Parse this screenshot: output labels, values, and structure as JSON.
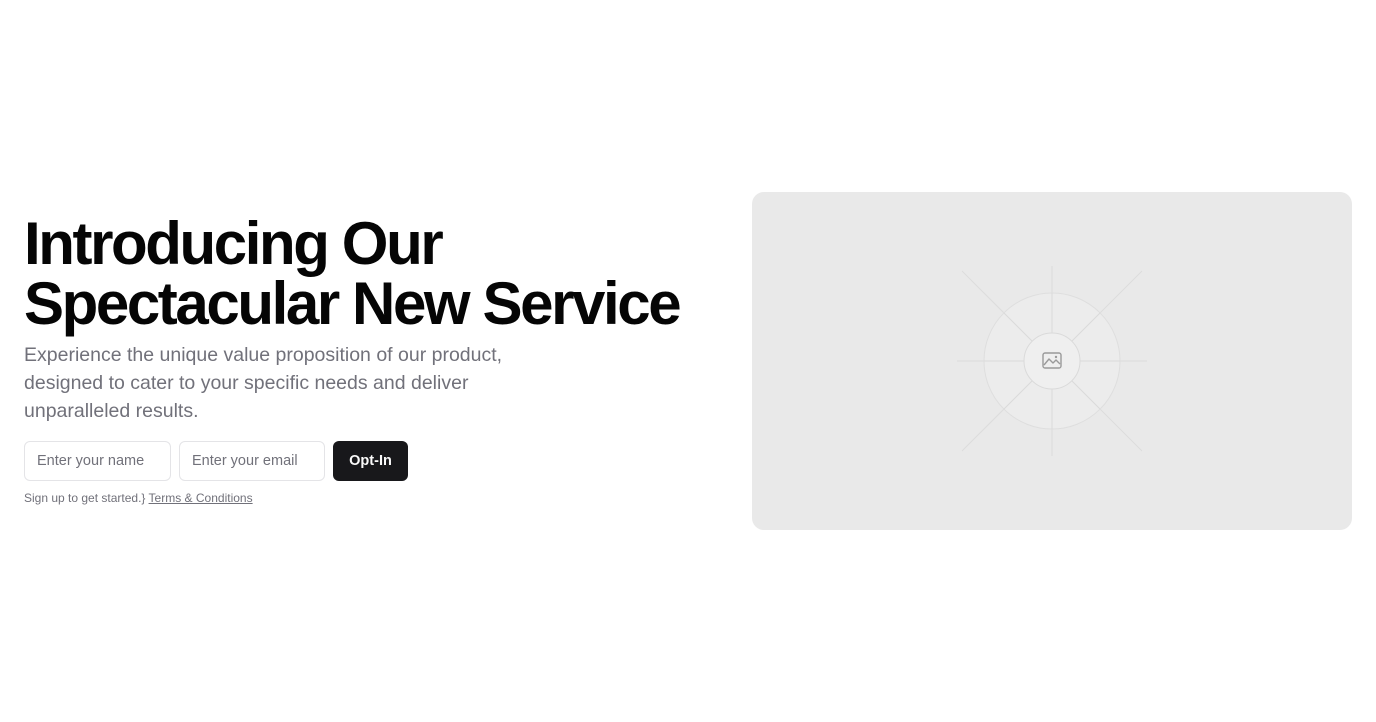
{
  "hero": {
    "headline_line1": "Introducing Our",
    "headline_line2": "Spectacular New Service",
    "subtext": "Experience the unique value proposition of our product, designed to cater to your specific needs and deliver unparalleled results."
  },
  "signup_form": {
    "name_placeholder": "Enter your name",
    "email_placeholder": "Enter your email",
    "name_value": "",
    "email_value": "",
    "submit_label": "Opt-In",
    "fine_print": "Sign up to get started.}",
    "terms_link": "Terms & Conditions"
  },
  "media": {
    "placeholder_icon": "image-placeholder-icon"
  },
  "colors": {
    "primary_button": "#18181b",
    "muted_text": "#71717a",
    "panel_background": "#e9e9e9"
  }
}
